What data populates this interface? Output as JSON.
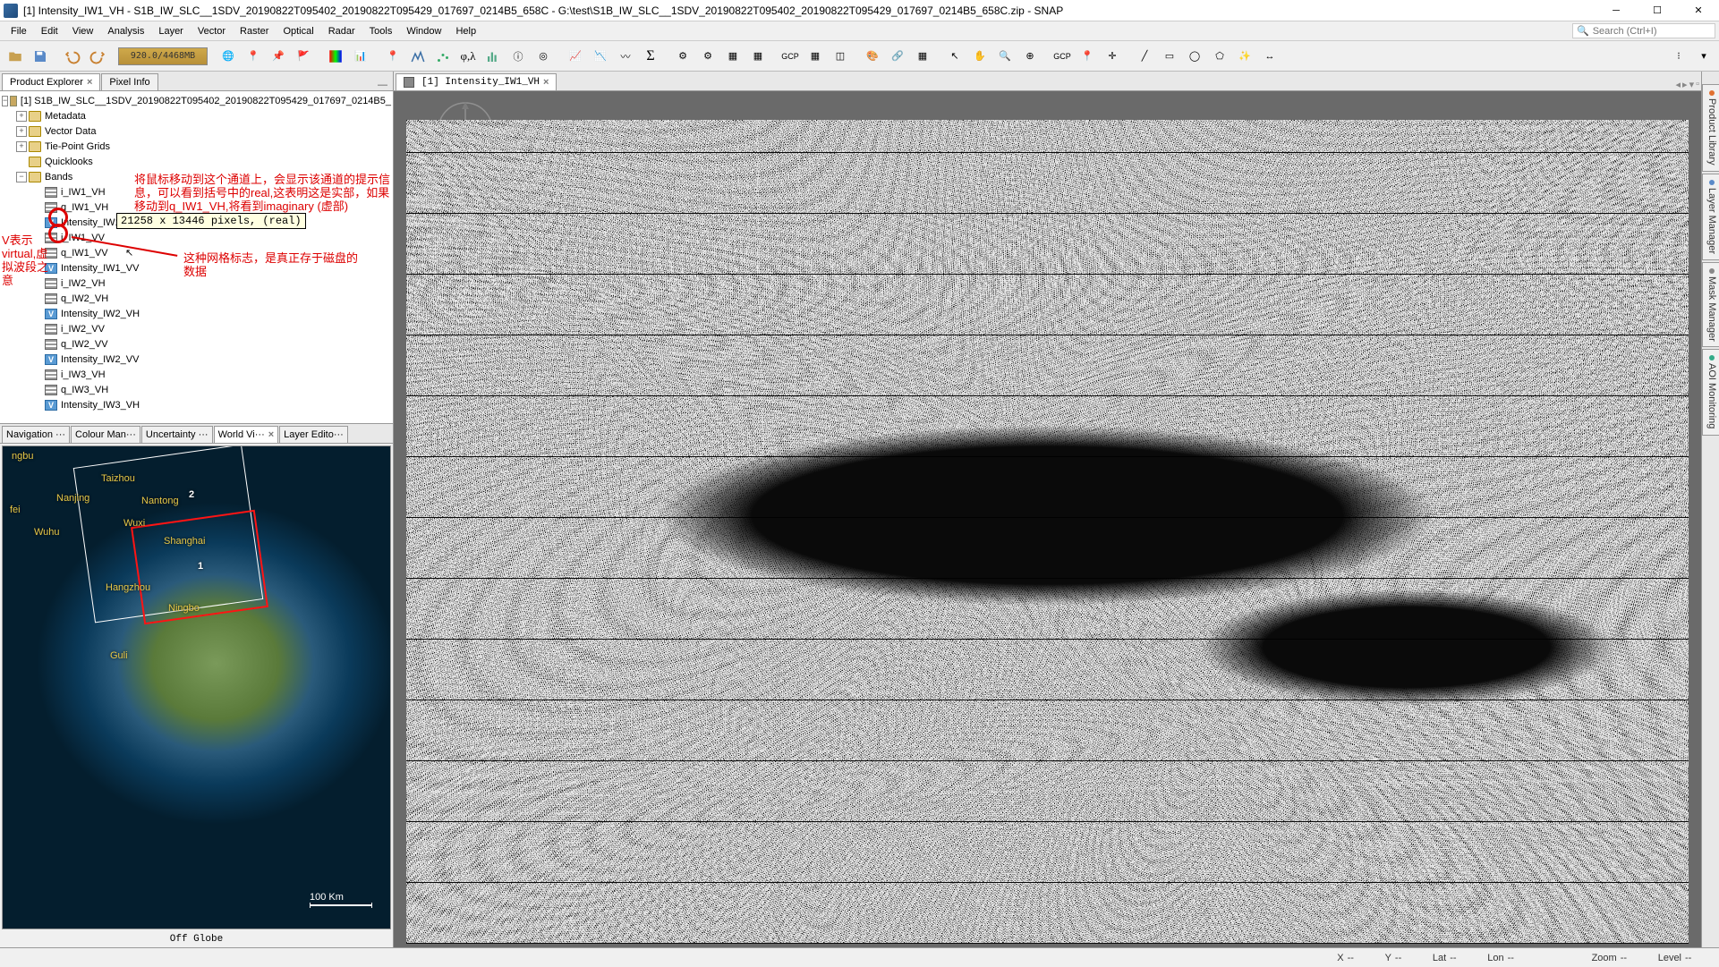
{
  "window": {
    "title": "[1] Intensity_IW1_VH - S1B_IW_SLC__1SDV_20190822T095402_20190822T095429_017697_0214B5_658C - G:\\test\\S1B_IW_SLC__1SDV_20190822T095402_20190822T095429_017697_0214B5_658C.zip - SNAP"
  },
  "menus": [
    "File",
    "Edit",
    "View",
    "Analysis",
    "Layer",
    "Vector",
    "Raster",
    "Optical",
    "Radar",
    "Tools",
    "Window",
    "Help"
  ],
  "search_placeholder": "Search (Ctrl+I)",
  "progress_text": "920.0/4468MB",
  "left_tabs": {
    "product_explorer": "Product Explorer",
    "pixel_info": "Pixel Info"
  },
  "tree": {
    "root": "[1] S1B_IW_SLC__1SDV_20190822T095402_20190822T095429_017697_0214B5_",
    "groups": [
      "Metadata",
      "Vector Data",
      "Tie-Point Grids",
      "Quicklooks",
      "Bands"
    ],
    "bands": [
      {
        "name": "i_IW1_VH",
        "virtual": false
      },
      {
        "name": "q_IW1_VH",
        "virtual": false
      },
      {
        "name": "Intensity_IW1_VH",
        "virtual": true
      },
      {
        "name": "i_IW1_VV",
        "virtual": false
      },
      {
        "name": "q_IW1_VV",
        "virtual": false
      },
      {
        "name": "Intensity_IW1_VV",
        "virtual": true
      },
      {
        "name": "i_IW2_VH",
        "virtual": false
      },
      {
        "name": "q_IW2_VH",
        "virtual": false
      },
      {
        "name": "Intensity_IW2_VH",
        "virtual": true
      },
      {
        "name": "i_IW2_VV",
        "virtual": false
      },
      {
        "name": "q_IW2_VV",
        "virtual": false
      },
      {
        "name": "Intensity_IW2_VV",
        "virtual": true
      },
      {
        "name": "i_IW3_VH",
        "virtual": false
      },
      {
        "name": "q_IW3_VH",
        "virtual": false
      },
      {
        "name": "Intensity_IW3_VH",
        "virtual": true
      }
    ]
  },
  "tooltip": "21258 x 13446 pixels, (real)",
  "annotations": {
    "a1": "将鼠标移动到这个通道上，会显示该通道的提示信息，可以看到括号中的real,这表明这是实部，如果移动到q_IW1_VH,将看到imaginary (虚部)",
    "a2": "V表示virtual,虚拟波段之意",
    "a3": "这种网格标志，是真正存于磁盘的数据"
  },
  "bottom_tabs": [
    "Navigation ···",
    "Colour Man···",
    "Uncertainty ···",
    "World Vi···",
    "Layer Edito···"
  ],
  "worldview": {
    "labels": [
      "ngbu",
      "Taizhou",
      "Nanjing",
      "Nantong",
      "fei",
      "Wuxi",
      "Wuhu",
      "Shanghai",
      "Hangzhou",
      "Ningbo",
      "Guli"
    ],
    "zone1": "1",
    "zone2": "2",
    "scale": "100 Km",
    "status": "Off Globe"
  },
  "image_tab": "[1] Intensity_IW1_VH",
  "right_tabs": [
    "Product Library",
    "Layer Manager",
    "Mask Manager",
    "AOI Monitoring"
  ],
  "statusbar": {
    "x_label": "X",
    "x_val": "--",
    "y_label": "Y",
    "y_val": "--",
    "lat_label": "Lat",
    "lat_val": "--",
    "lon_label": "Lon",
    "lon_val": "--",
    "zoom_label": "Zoom",
    "zoom_val": "--",
    "level_label": "Level",
    "level_val": "--"
  }
}
